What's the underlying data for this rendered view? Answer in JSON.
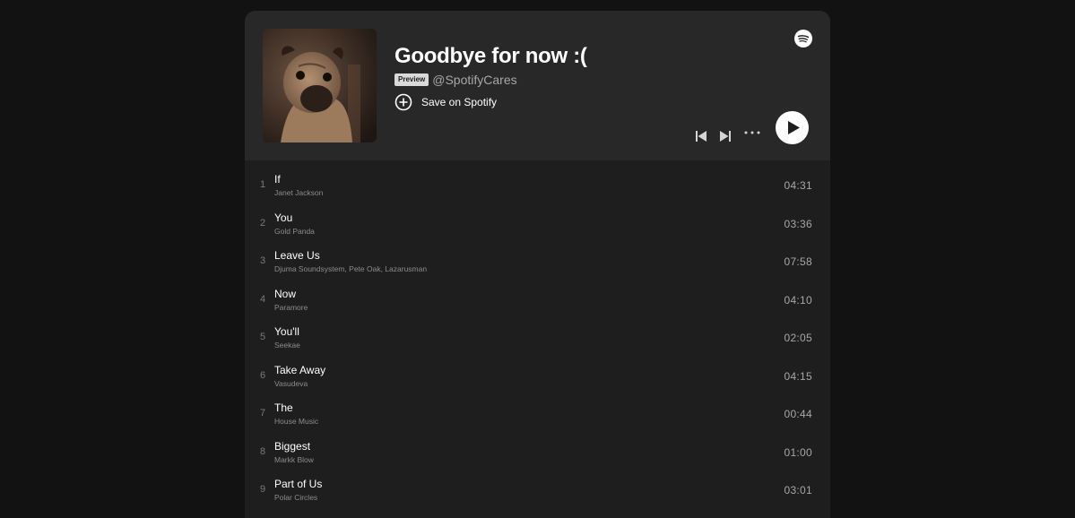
{
  "playlist": {
    "title": "Goodbye for now :(",
    "badge": "Preview",
    "owner": "@SpotifyCares",
    "save_label": "Save on Spotify"
  },
  "icons": {
    "logo": "spotify-logo-icon",
    "save": "plus-circle-icon",
    "prev": "skip-back-icon",
    "next": "skip-forward-icon",
    "more": "more-options-icon",
    "play": "play-icon"
  },
  "colors": {
    "background": "#121212",
    "header": "#282828",
    "list": "#1e1e1e",
    "text": "#ffffff",
    "subtext": "#8c8c8c"
  },
  "tracks": [
    {
      "num": "1",
      "title": "If",
      "artist": "Janet Jackson",
      "duration": "04:31"
    },
    {
      "num": "2",
      "title": "You",
      "artist": "Gold Panda",
      "duration": "03:36"
    },
    {
      "num": "3",
      "title": "Leave Us",
      "artist": "Djuma Soundsystem, Pete Oak, Lazarusman",
      "duration": "07:58"
    },
    {
      "num": "4",
      "title": "Now",
      "artist": "Paramore",
      "duration": "04:10"
    },
    {
      "num": "5",
      "title": "You'll",
      "artist": "Seekae",
      "duration": "02:05"
    },
    {
      "num": "6",
      "title": "Take Away",
      "artist": "Vasudeva",
      "duration": "04:15"
    },
    {
      "num": "7",
      "title": "The",
      "artist": "House Music",
      "duration": "00:44"
    },
    {
      "num": "8",
      "title": "Biggest",
      "artist": "Markk Blow",
      "duration": "01:00"
    },
    {
      "num": "9",
      "title": "Part of Us",
      "artist": "Polar Circles",
      "duration": "03:01"
    }
  ]
}
